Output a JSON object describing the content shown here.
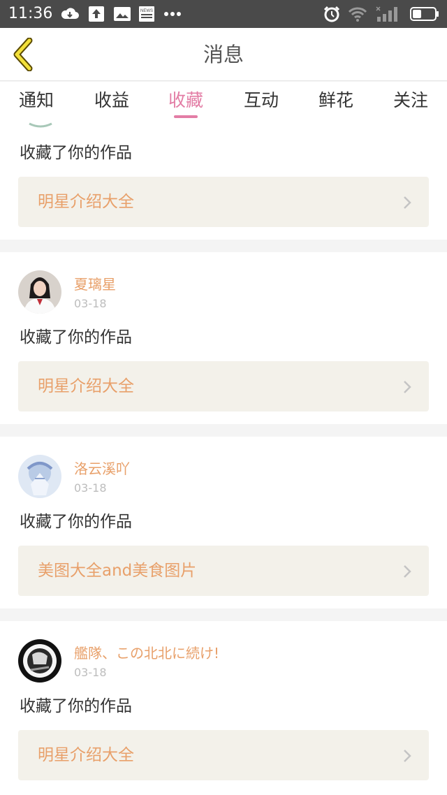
{
  "status_bar": {
    "time": "11:36",
    "news_label": "NEWS",
    "icons": [
      "cloud-icon",
      "upload-icon",
      "picture-icon",
      "news-icon",
      "more-icon",
      "alarm-icon",
      "wifi-icon",
      "signal-icon",
      "battery-icon"
    ]
  },
  "header": {
    "title": "消息",
    "back_icon": "chevron-left-icon"
  },
  "tabs": [
    {
      "label": "通知"
    },
    {
      "label": "收益"
    },
    {
      "label": "收藏",
      "active": true
    },
    {
      "label": "互动"
    },
    {
      "label": "鲜花"
    },
    {
      "label": "关注"
    }
  ],
  "colors": {
    "accent_pink": "#e37da5",
    "accent_orange": "#e8a06a",
    "card_bg": "#f3f1ea"
  },
  "feed": [
    {
      "name": "",
      "date": "",
      "action": "收藏了你的作品",
      "work": "明星介绍大全"
    },
    {
      "name": "夏璃星",
      "date": "03-18",
      "action": "收藏了你的作品",
      "work": "明星介绍大全"
    },
    {
      "name": "洛云溪吖",
      "date": "03-18",
      "action": "收藏了你的作品",
      "work": "美图大全and美食图片"
    },
    {
      "name": "艦隊、この北北に続け!",
      "date": "03-18",
      "action": "收藏了你的作品",
      "work": "明星介绍大全"
    }
  ]
}
